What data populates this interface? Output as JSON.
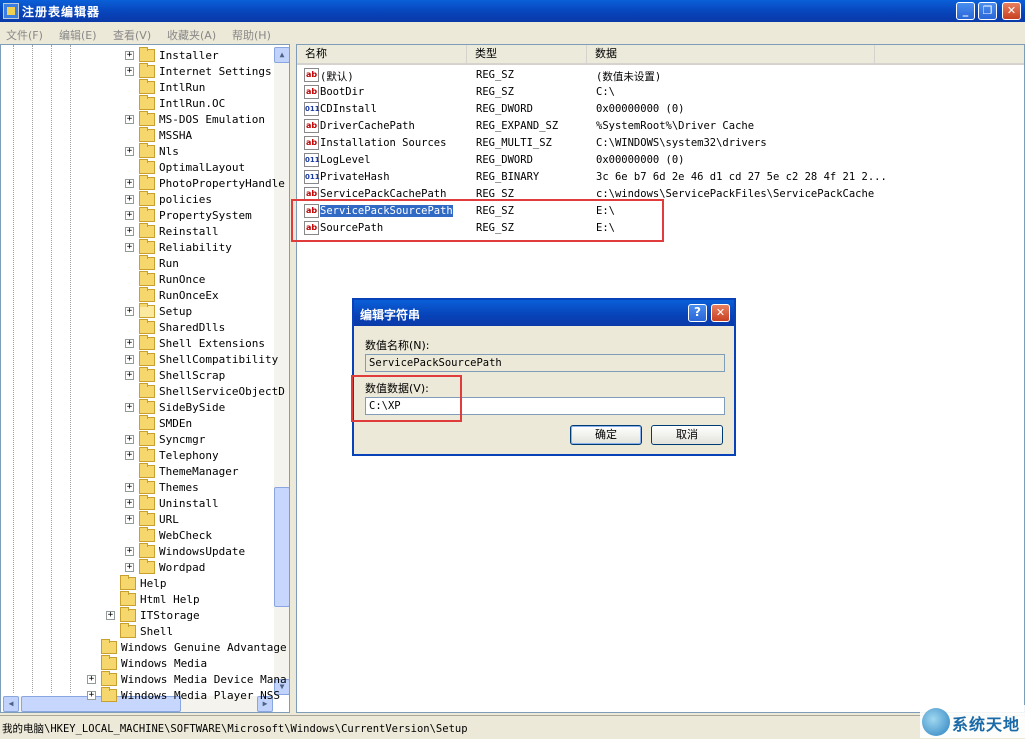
{
  "window": {
    "title": "注册表编辑器"
  },
  "menu": [
    "文件(F)",
    "编辑(E)",
    "查看(V)",
    "收藏夹(A)",
    "帮助(H)"
  ],
  "tree": {
    "level2_items": [
      {
        "label": "Installer",
        "expand": true
      },
      {
        "label": "Internet Settings",
        "expand": true
      },
      {
        "label": "IntlRun",
        "expand": false
      },
      {
        "label": "IntlRun.OC",
        "expand": false
      },
      {
        "label": "MS-DOS Emulation",
        "expand": true
      },
      {
        "label": "MSSHA",
        "expand": false
      },
      {
        "label": "Nls",
        "expand": true
      },
      {
        "label": "OptimalLayout",
        "expand": false
      },
      {
        "label": "PhotoPropertyHandle",
        "expand": true
      },
      {
        "label": "policies",
        "expand": true
      },
      {
        "label": "PropertySystem",
        "expand": true
      },
      {
        "label": "Reinstall",
        "expand": true
      },
      {
        "label": "Reliability",
        "expand": true
      },
      {
        "label": "Run",
        "expand": false
      },
      {
        "label": "RunOnce",
        "expand": false
      },
      {
        "label": "RunOnceEx",
        "expand": false
      },
      {
        "label": "Setup",
        "expand": true,
        "open": true
      },
      {
        "label": "SharedDlls",
        "expand": false
      },
      {
        "label": "Shell Extensions",
        "expand": true
      },
      {
        "label": "ShellCompatibility",
        "expand": true
      },
      {
        "label": "ShellScrap",
        "expand": true
      },
      {
        "label": "ShellServiceObjectD",
        "expand": false
      },
      {
        "label": "SideBySide",
        "expand": true
      },
      {
        "label": "SMDEn",
        "expand": false
      },
      {
        "label": "Syncmgr",
        "expand": true
      },
      {
        "label": "Telephony",
        "expand": true
      },
      {
        "label": "ThemeManager",
        "expand": false
      },
      {
        "label": "Themes",
        "expand": true
      },
      {
        "label": "Uninstall",
        "expand": true
      },
      {
        "label": "URL",
        "expand": true
      },
      {
        "label": "WebCheck",
        "expand": false
      },
      {
        "label": "WindowsUpdate",
        "expand": true
      },
      {
        "label": "Wordpad",
        "expand": true
      }
    ],
    "level1_items": [
      {
        "label": "Help",
        "expand": false
      },
      {
        "label": "Html Help",
        "expand": false
      },
      {
        "label": "ITStorage",
        "expand": true
      },
      {
        "label": "Shell",
        "expand": false
      }
    ],
    "level0_items": [
      {
        "label": "Windows Genuine Advantage",
        "expand": false
      },
      {
        "label": "Windows Media",
        "expand": false
      },
      {
        "label": "Windows Media Device Mana",
        "expand": true
      },
      {
        "label": "Windows Media Player NSS",
        "expand": true
      }
    ]
  },
  "columns": [
    "名称",
    "类型",
    "数据"
  ],
  "values": [
    {
      "name": "(默认)",
      "type": "REG_SZ",
      "data": "(数值未设置)",
      "icon": "ab"
    },
    {
      "name": "BootDir",
      "type": "REG_SZ",
      "data": "C:\\",
      "icon": "ab"
    },
    {
      "name": "CDInstall",
      "type": "REG_DWORD",
      "data": "0x00000000 (0)",
      "icon": "bin"
    },
    {
      "name": "DriverCachePath",
      "type": "REG_EXPAND_SZ",
      "data": "%SystemRoot%\\Driver Cache",
      "icon": "ab"
    },
    {
      "name": "Installation Sources",
      "type": "REG_MULTI_SZ",
      "data": "C:\\WINDOWS\\system32\\drivers",
      "icon": "ab"
    },
    {
      "name": "LogLevel",
      "type": "REG_DWORD",
      "data": "0x00000000 (0)",
      "icon": "bin"
    },
    {
      "name": "PrivateHash",
      "type": "REG_BINARY",
      "data": "3c 6e b7 6d 2e 46 d1 cd 27 5e c2 28 4f 21 2...",
      "icon": "bin"
    },
    {
      "name": "ServicePackCachePath",
      "type": "REG_SZ",
      "data": "c:\\windows\\ServicePackFiles\\ServicePackCache",
      "icon": "ab"
    },
    {
      "name": "ServicePackSourcePath",
      "type": "REG_SZ",
      "data": "E:\\",
      "icon": "ab",
      "selected": true
    },
    {
      "name": "SourcePath",
      "type": "REG_SZ",
      "data": "E:\\",
      "icon": "ab"
    }
  ],
  "dialog": {
    "title": "编辑字符串",
    "help_label": "?",
    "close_label": "✕",
    "name_label": "数值名称(N):",
    "name_value": "ServicePackSourcePath",
    "data_label": "数值数据(V):",
    "data_value": "C:\\XP",
    "ok_label": "确定",
    "cancel_label": "取消"
  },
  "status": {
    "path": "我的电脑\\HKEY_LOCAL_MACHINE\\SOFTWARE\\Microsoft\\Windows\\CurrentVersion\\Setup"
  },
  "watermark": {
    "text": "系统天地"
  },
  "colors": {
    "title_blue": "#0842b8",
    "selection": "#316ac5",
    "highlight_red": "#e03c3c"
  }
}
